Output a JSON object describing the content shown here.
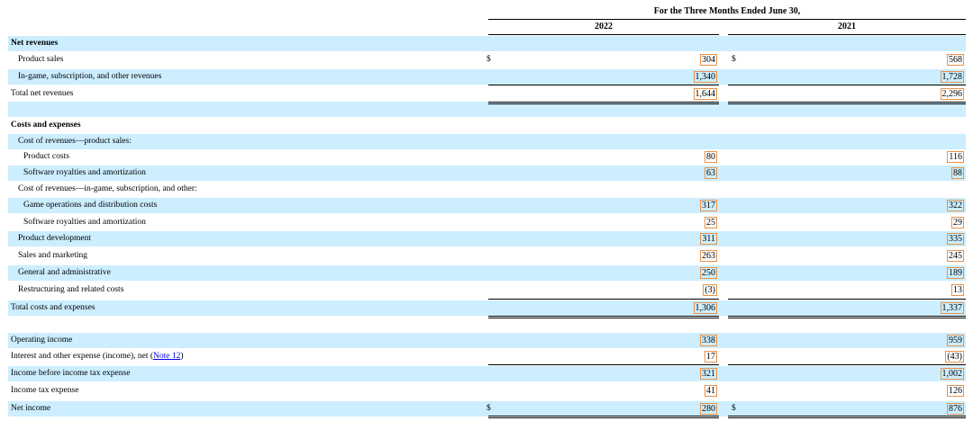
{
  "header": {
    "period": "For the Three Months Ended June 30,",
    "col1": "2022",
    "col2": "2021"
  },
  "rows": [
    {
      "label": "Net revenues",
      "bold": true,
      "indent": 0,
      "shade": true,
      "v1": "",
      "v2": ""
    },
    {
      "label": "Product sales",
      "indent": 1,
      "shade": false,
      "cur1": "$",
      "v1": "304",
      "cur2": "$",
      "v2": "568"
    },
    {
      "label": "In-game, subscription, and other revenues",
      "indent": 1,
      "shade": true,
      "v1": "1,340",
      "v2": "1,728"
    },
    {
      "label": "Total net revenues",
      "indent": 0,
      "shade": false,
      "v1": "1,644",
      "v2": "2,296"
    },
    {
      "label": "",
      "indent": 0,
      "shade": true,
      "v1": "",
      "v2": ""
    },
    {
      "label": "Costs and expenses",
      "bold": true,
      "indent": 0,
      "shade": false,
      "v1": "",
      "v2": ""
    },
    {
      "label": "Cost of revenues—product sales:",
      "indent": 1,
      "shade": true,
      "v1": "",
      "v2": ""
    },
    {
      "label": "Product costs",
      "indent": 2,
      "shade": false,
      "v1": "80",
      "v2": "116"
    },
    {
      "label": "Software royalties and amortization",
      "indent": 2,
      "shade": true,
      "v1": "63",
      "v2": "88"
    },
    {
      "label": "Cost of revenues—in-game, subscription, and other:",
      "indent": 1,
      "shade": false,
      "v1": "",
      "v2": ""
    },
    {
      "label": "Game operations and distribution costs",
      "indent": 2,
      "shade": true,
      "v1": "317",
      "v2": "322"
    },
    {
      "label": "Software royalties and amortization",
      "indent": 2,
      "shade": false,
      "v1": "25",
      "v2": "29"
    },
    {
      "label": "Product development",
      "indent": 1,
      "shade": true,
      "v1": "311",
      "v2": "335"
    },
    {
      "label": "Sales and marketing",
      "indent": 1,
      "shade": false,
      "v1": "263",
      "v2": "245"
    },
    {
      "label": "General and administrative",
      "indent": 1,
      "shade": true,
      "v1": "250",
      "v2": "189"
    },
    {
      "label": "Restructuring and related costs",
      "indent": 1,
      "shade": false,
      "v1": "(3)",
      "v2": "13"
    },
    {
      "label": "Total costs and expenses",
      "indent": 0,
      "shade": true,
      "v1": "1,306",
      "v2": "1,337"
    },
    {
      "label": "",
      "indent": 0,
      "shade": false,
      "v1": "",
      "v2": ""
    },
    {
      "label": "Operating income",
      "indent": 0,
      "shade": true,
      "v1": "338",
      "v2": "959"
    },
    {
      "label": "Interest and other expense (income), net",
      "link": "Note 12",
      "indent": 0,
      "shade": false,
      "v1": "17",
      "v2": "(43)"
    },
    {
      "label": "Income before income tax expense",
      "indent": 0,
      "shade": true,
      "v1": "321",
      "v2": "1,002"
    },
    {
      "label": "Income tax expense",
      "indent": 0,
      "shade": false,
      "v1": "41",
      "v2": "126"
    },
    {
      "label": "Net income",
      "indent": 0,
      "shade": true,
      "cur1": "$",
      "v1": "280",
      "cur2": "$",
      "v2": "876"
    }
  ],
  "colors": {
    "shade": "#cceeff",
    "highlight_border": "#e8924a",
    "link": "#0000ee"
  }
}
